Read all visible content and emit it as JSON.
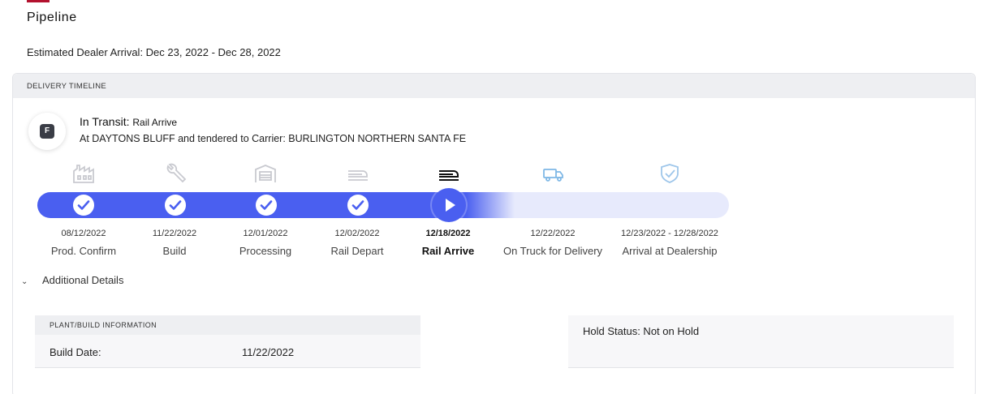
{
  "header": {
    "title": "Pipeline",
    "eta_label": "Estimated Dealer Arrival: Dec 23, 2022 - Dec 28, 2022"
  },
  "timeline": {
    "section_title": "DELIVERY TIMELINE",
    "status_badge_letter": "F",
    "status_prefix": "In Transit:",
    "status_value": "Rail Arrive",
    "status_description": "At DAYTONS BLUFF and tendered to Carrier: BURLINGTON NORTHERN SANTA FE",
    "accent_color": "#4a5ff0",
    "steps": [
      {
        "date": "08/12/2022",
        "label": "Prod. Confirm",
        "icon": "factory-icon",
        "state": "complete"
      },
      {
        "date": "11/22/2022",
        "label": "Build",
        "icon": "wrench-icon",
        "state": "complete"
      },
      {
        "date": "12/01/2022",
        "label": "Processing",
        "icon": "garage-icon",
        "state": "complete"
      },
      {
        "date": "12/02/2022",
        "label": "Rail Depart",
        "icon": "train-icon",
        "state": "complete"
      },
      {
        "date": "12/18/2022",
        "label": "Rail Arrive",
        "icon": "train-icon",
        "state": "current"
      },
      {
        "date": "12/22/2022",
        "label": "On Truck for Delivery",
        "icon": "truck-icon",
        "state": "upcoming"
      },
      {
        "date": "12/23/2022 - 12/28/2022",
        "label": "Arrival at Dealership",
        "icon": "shield-check-icon",
        "state": "upcoming"
      }
    ]
  },
  "details": {
    "toggle_label": "Additional Details",
    "plant_section_title": "PLANT/BUILD INFORMATION",
    "build_date_label": "Build Date:",
    "build_date_value": "11/22/2022",
    "hold_status": "Hold Status: Not on Hold"
  }
}
